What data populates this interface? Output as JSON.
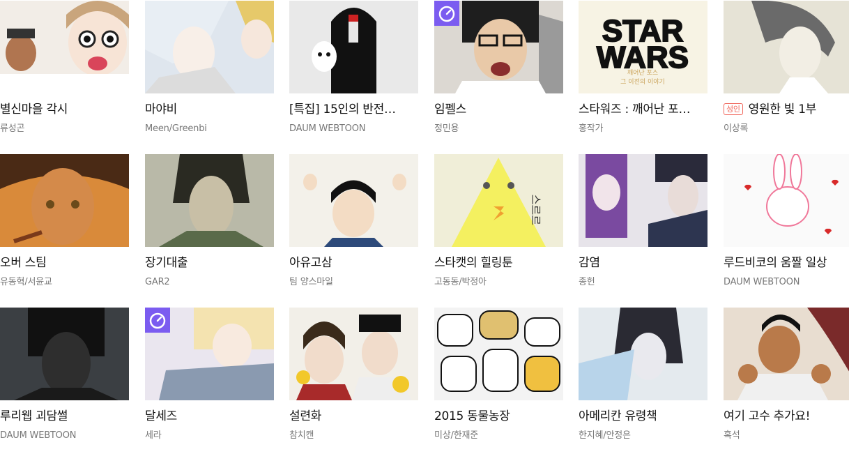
{
  "rows": [
    [
      {
        "title": "별신마을 각시",
        "author": "류성곤",
        "bg": "#f2ede7",
        "timer": false,
        "adult": false
      },
      {
        "title": "마야비",
        "author": "Meen/Greenbi",
        "bg": "#dfe6ee",
        "timer": false,
        "adult": false
      },
      {
        "title": "[특집] 15인의 반전…",
        "author": "DAUM WEBTOON",
        "bg": "#e9e9e9",
        "timer": false,
        "adult": false
      },
      {
        "title": "임펠스",
        "author": "정민용",
        "bg": "#dcd8d2",
        "timer": true,
        "adult": false
      },
      {
        "title": "스타워즈 : 깨어난 포…",
        "author": "홍작가",
        "bg": "#f7f3e4",
        "timer": false,
        "adult": false
      },
      {
        "title": "영원한 빛 1부",
        "author": "이상록",
        "bg": "#e6e3d6",
        "timer": false,
        "adult": true
      }
    ],
    [
      {
        "title": "오버 스팀",
        "author": "유동혁/서윤교",
        "bg": "#d98a3a",
        "timer": false,
        "adult": false
      },
      {
        "title": "장기대출",
        "author": "GAR2",
        "bg": "#b9b9a8",
        "timer": false,
        "adult": false
      },
      {
        "title": "아유고삼",
        "author": "팀 양스마일",
        "bg": "#f3f1ea",
        "timer": false,
        "adult": false
      },
      {
        "title": "스타캣의 힐링툰",
        "author": "고동동/박정아",
        "bg": "#f0eed8",
        "timer": false,
        "adult": false
      },
      {
        "title": "감염",
        "author": "종헌",
        "bg": "#e7e4ea",
        "timer": false,
        "adult": false
      },
      {
        "title": "루드비코의 움짤 일상",
        "author": "DAUM WEBTOON",
        "bg": "#fafafa",
        "timer": false,
        "adult": false
      }
    ],
    [
      {
        "title": "루리웹 괴담썰",
        "author": "DAUM WEBTOON",
        "bg": "#3b3f43",
        "timer": false,
        "adult": false
      },
      {
        "title": "달세즈",
        "author": "세라",
        "bg": "#eae6ef",
        "timer": true,
        "adult": false
      },
      {
        "title": "설련화",
        "author": "참치캔",
        "bg": "#f2efe8",
        "timer": false,
        "adult": false
      },
      {
        "title": "2015 동물농장",
        "author": "미상/한재준",
        "bg": "#f3f3f3",
        "timer": false,
        "adult": false
      },
      {
        "title": "아메리칸 유령책",
        "author": "한지혜/안정은",
        "bg": "#e4eaee",
        "timer": false,
        "adult": false
      },
      {
        "title": "여기 고수 추가요!",
        "author": "혹석",
        "bg": "#e8ddd0",
        "timer": false,
        "adult": false
      }
    ]
  ],
  "labels": {
    "adult_badge": "성인"
  },
  "thumb_text": {
    "starwars_line1": "STAR",
    "starwars_line2": "WARS",
    "starwars_sub1": "깨어난 포스",
    "starwars_sub2": "그 이전의 이야기",
    "starcat": "스르르"
  },
  "colors": {
    "timer_badge": "#7b5cf0",
    "adult_badge": "#f0665b",
    "title": "#111111",
    "author": "#777777"
  }
}
